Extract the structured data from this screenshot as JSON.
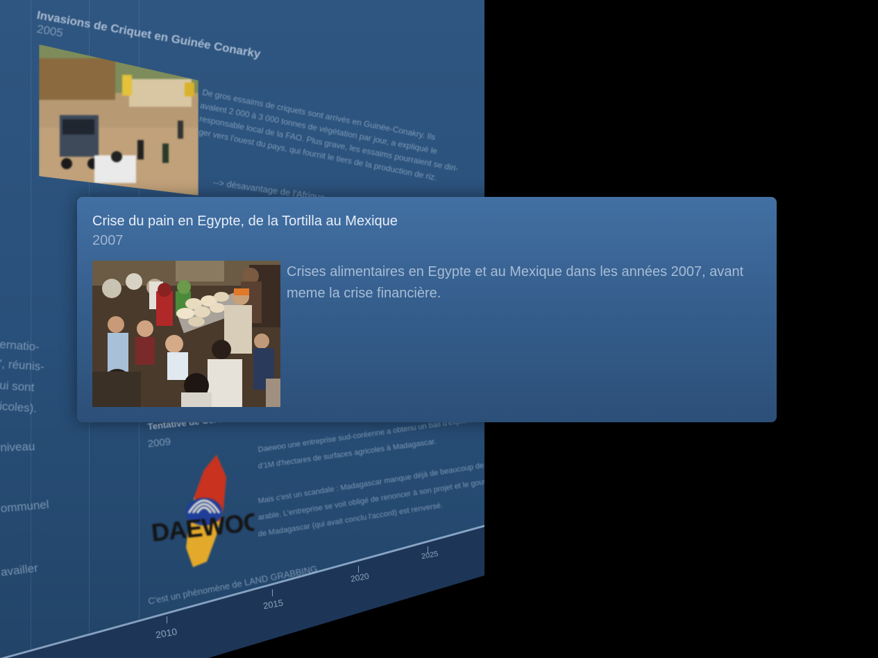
{
  "background_panel": {
    "top_event": {
      "title": "Invasions de Criquet en Guinée Conarky",
      "year": "2005",
      "description_lines": [
        "De gros essaims de criquets sont arrivés en Guinée-Conakry. Ils",
        "avalent 2 000 à 3 000 tonnes de végétation par jour, a expliqué le",
        "responsable local de la FAO. Plus grave, les essaims pourraient se diri-",
        "ger vers l'ouest du pays, qui fournit le tiers de la production de riz."
      ],
      "note": "--> désavantage de l'Afrique"
    },
    "left_fragments": [
      "ernatio-",
      "', réunis-",
      "ui sont",
      "icoles).",
      "niveau",
      "ommunel",
      "availler"
    ],
    "bottom_event": {
      "title": "Tentative de Corée du Sud à Madagascar par Daewoo",
      "year": "2009",
      "description_lines": [
        "Daewoo une entreprise sud-coréenne a obtenu un bail d'exploitation de plus",
        "d'1M d'hectares de surfaces agricoles à Madagascar.",
        "",
        "Mais c'est un scandale : Madagascar manque déjà de beaucoup de terres",
        "arable. L'entreprise se voit obligé de renoncer à son projet et le gouvernement",
        "de Madagascar (qui avait conclu l'accord) est renversé."
      ],
      "caption": "C'est un phénomène de LAND GRABBING",
      "logo_text": "DAEWOO"
    },
    "axis_years": [
      "2010",
      "2015",
      "2020",
      "2025"
    ]
  },
  "card": {
    "title": "Crise du pain en Egypte, de la Tortilla au Mexique",
    "year": "2007",
    "description": "Crises alimentaires en Egypte et au Mexique dans les années 2007, avant meme la crise financière.",
    "photo": "crowd-with-bread-photo"
  },
  "colors": {
    "card_top": "#4270a3",
    "card_bottom": "#2c4f78",
    "panel": "#2f5680",
    "background": "#000000"
  }
}
